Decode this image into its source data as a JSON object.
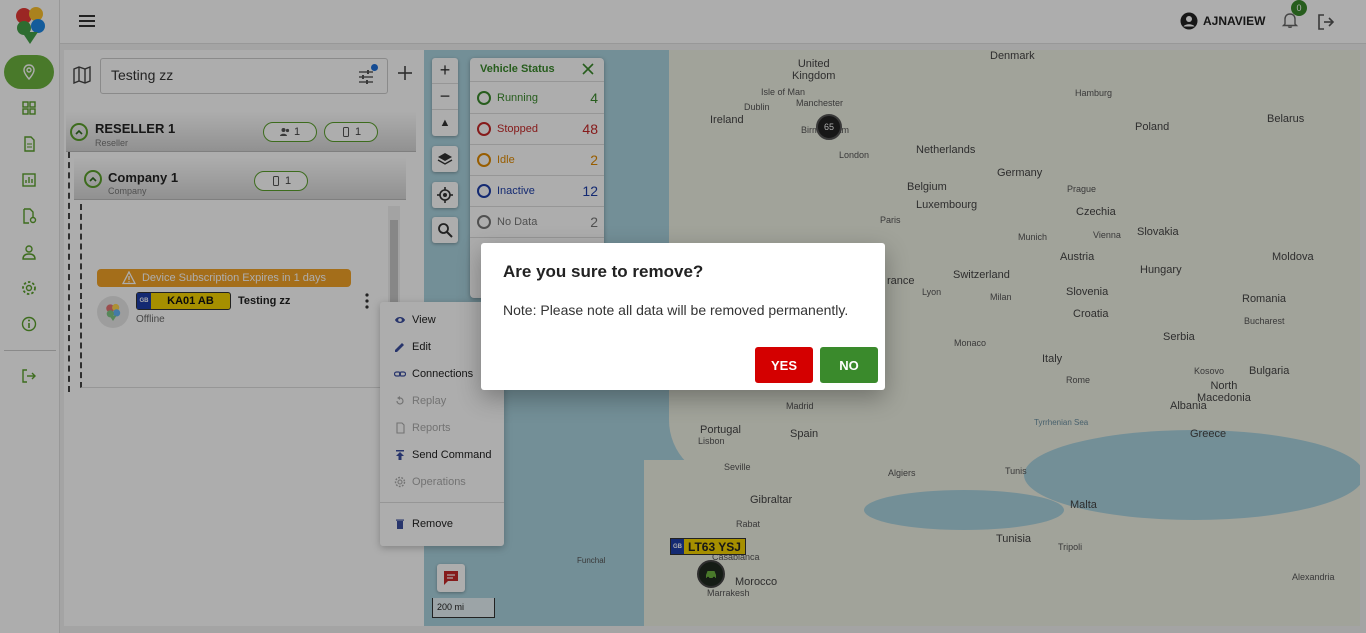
{
  "header": {
    "user_name": "AJNAVIEW",
    "notification_count": "0"
  },
  "left_panel": {
    "search_value": "Testing zz",
    "reseller": {
      "title": "RESELLER 1",
      "subtitle": "Reseller",
      "users_count": "1",
      "devices_count": "1"
    },
    "company": {
      "title": "Company 1",
      "subtitle": "Company",
      "devices_count": "1"
    },
    "device": {
      "subscription_banner": "Device Subscription Expires in 1 days",
      "plate_country": "GB",
      "plate_number": "KA01 AB",
      "name": "Testing zz",
      "status": "Offline"
    }
  },
  "context_menu": {
    "items": [
      {
        "label": "View",
        "icon": "eye-icon",
        "enabled": true
      },
      {
        "label": "Edit",
        "icon": "pencil-icon",
        "enabled": true
      },
      {
        "label": "Connections",
        "icon": "link-icon",
        "enabled": true
      },
      {
        "label": "Replay",
        "icon": "replay-icon",
        "enabled": false
      },
      {
        "label": "Reports",
        "icon": "document-icon",
        "enabled": false
      },
      {
        "label": "Send Command",
        "icon": "upload-icon",
        "enabled": true
      },
      {
        "label": "Operations",
        "icon": "gear-icon",
        "enabled": false
      },
      {
        "label": "Remove",
        "icon": "trash-icon",
        "enabled": true
      }
    ]
  },
  "vehicle_status": {
    "title": "Vehicle Status",
    "rows": [
      {
        "label": "Running",
        "count": "4",
        "color": "#3a8a2c"
      },
      {
        "label": "Stopped",
        "count": "48",
        "color": "#c62828"
      },
      {
        "label": "Idle",
        "count": "2",
        "color": "#e08a00"
      },
      {
        "label": "Inactive",
        "count": "12",
        "color": "#1e3ea8"
      },
      {
        "label": "No Data",
        "count": "2",
        "color": "#777777"
      }
    ]
  },
  "map": {
    "cluster_count": "65",
    "vehicle_plate_country": "GB",
    "vehicle_plate": "LT63 YSJ",
    "scale_label": "200 mi",
    "places": {
      "denmark": "Denmark",
      "united_kingdom": "United\nKingdom",
      "isle_of_man": "Isle of Man",
      "dublin": "Dublin",
      "manchester": "Manchester",
      "ireland": "Ireland",
      "birmingham": "Birmingham",
      "london": "London",
      "hamburg": "Hamburg",
      "poland": "Poland",
      "belarus": "Belarus",
      "netherlands": "Netherlands",
      "germany": "Germany",
      "belgium": "Belgium",
      "luxembourg": "Luxembourg",
      "prague": "Prague",
      "czechia": "Czechia",
      "paris": "Paris",
      "munich": "Munich",
      "vienna": "Vienna",
      "slovakia": "Slovakia",
      "austria": "Austria",
      "hungary": "Hungary",
      "moldova": "Moldova",
      "switzerland": "Switzerland",
      "lyon": "Lyon",
      "milan": "Milan",
      "slovenia": "Slovenia",
      "croatia": "Croatia",
      "romania": "Romania",
      "bucharest": "Bucharest",
      "serbia": "Serbia",
      "france": "rance",
      "monaco": "Monaco",
      "italy": "Italy",
      "bulgaria": "Bulgaria",
      "kosovo": "Kosovo",
      "rome": "Rome",
      "albania": "Albania",
      "north_macedonia": "North\nMacedonia",
      "portugal": "Portugal",
      "madrid": "Madrid",
      "spain": "Spain",
      "lisbon": "Lisbon",
      "seville": "Seville",
      "greece": "Greece",
      "tyrrhenian_sea": "Tyrrhenian Sea",
      "algiers": "Algiers",
      "tunis": "Tunis",
      "gibraltar": "Gibraltar",
      "rabat": "Rabat",
      "malta": "Malta",
      "tunisia": "Tunisia",
      "casablanca": "Casablanca",
      "funchal": "Funchal",
      "morocco": "Morocco",
      "marrakesh": "Marrakesh",
      "tripoli": "Tripoli",
      "alexandria": "Alexandria",
      "rra": "rra"
    }
  },
  "dialog": {
    "title": "Are you sure to remove?",
    "message": "Note: Please note all data will be removed permanently.",
    "yes_label": "YES",
    "no_label": "NO"
  }
}
